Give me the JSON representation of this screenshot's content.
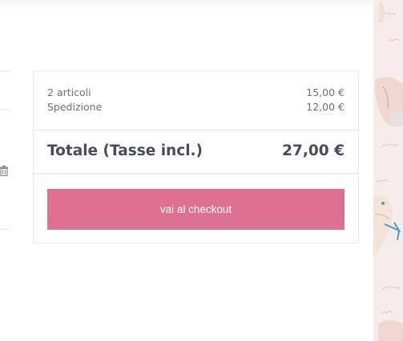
{
  "summary": {
    "articles_label": "2 articoli",
    "articles_value": "15,00 €",
    "shipping_label": "Spedizione",
    "shipping_value": "12,00 €",
    "total_label": "Totale (Tasse incl.)",
    "total_value": "27,00 €",
    "checkout_label": "vai al checkout"
  },
  "colors": {
    "accent": "#de7090",
    "total_text": "#484a5e",
    "side_pattern_bg": "#f7ecec"
  },
  "icons": {
    "delete": "trash-icon",
    "background": "cloud-pattern"
  }
}
